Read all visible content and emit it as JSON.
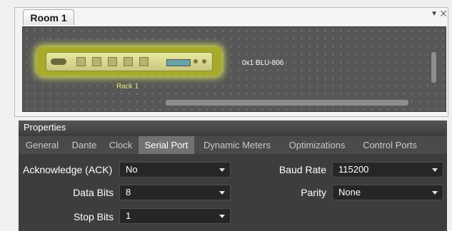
{
  "room": {
    "tab_label": "Room 1",
    "menu_icon": "chevron-down-icon",
    "close_icon": "close-icon"
  },
  "canvas": {
    "rack_label": "Rack 1",
    "device_label": "0x1  BLU-806",
    "rack_color": "#d7e35a",
    "background": "#575757"
  },
  "properties": {
    "title": "Properties",
    "tabs": [
      {
        "label": "General"
      },
      {
        "label": "Dante"
      },
      {
        "label": "Clock"
      },
      {
        "label": "Serial Port"
      },
      {
        "label": "Dynamic Meters"
      },
      {
        "label": "Optimizations"
      },
      {
        "label": "Control Ports"
      }
    ],
    "active_tab": "Serial Port",
    "fields": {
      "ack": {
        "label": "Acknowledge (ACK)",
        "value": "No"
      },
      "data_bits": {
        "label": "Data Bits",
        "value": "8"
      },
      "stop_bits": {
        "label": "Stop Bits",
        "value": "1"
      },
      "baud_rate": {
        "label": "Baud Rate",
        "value": "115200"
      },
      "parity": {
        "label": "Parity",
        "value": "None"
      }
    }
  }
}
